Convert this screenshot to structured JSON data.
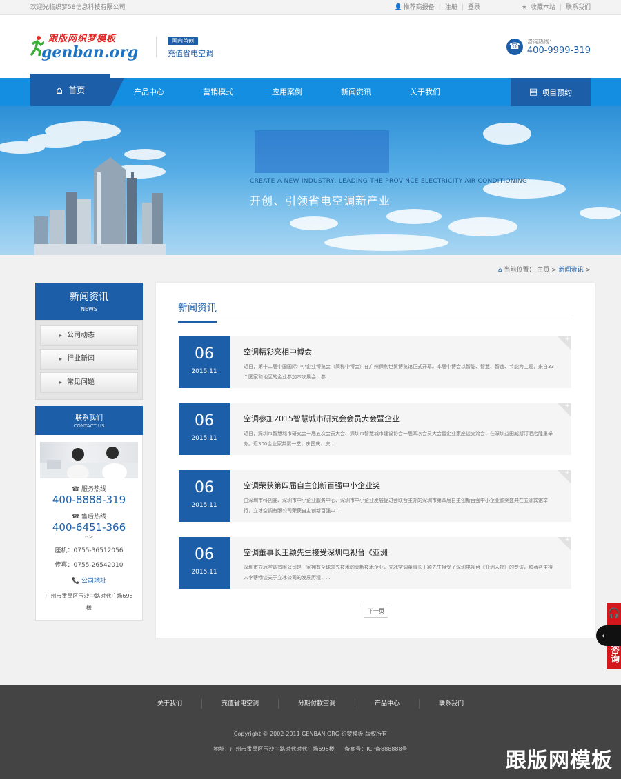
{
  "topbar": {
    "welcome": "欢迎光临织梦58信息科技有限公司",
    "links": [
      "推荐商报备",
      "注册",
      "登录"
    ],
    "right_links": [
      "收藏本站",
      "联系我们"
    ]
  },
  "header": {
    "logo_cn": "跟版网织梦模板",
    "logo_en": "genban.org",
    "badge": "国内首创",
    "slogan": "充值省电空调",
    "hotline_label": "咨询热线：",
    "hotline_number": "400-9999-319"
  },
  "nav": {
    "home": "首页",
    "items": [
      "产品中心",
      "营销模式",
      "应用案例",
      "新闻资讯",
      "关于我们"
    ],
    "book": "项目预约"
  },
  "banner": {
    "en": "CREATE A NEW INDUSTRY, LEADING THE PROVINCE ELECTRICITY AIR CONDITIONING",
    "cn": "开创、引领省电空调新产业"
  },
  "breadcrumb": {
    "prefix": "当前位置：",
    "home": "主页",
    "sep": ">",
    "current": "新闻资讯",
    "trail": ">"
  },
  "sidebar": {
    "title": "新闻资讯",
    "subtitle": "NEWS",
    "menu": [
      "公司动态",
      "行业新闻",
      "常见问题"
    ],
    "contact_title": "联系我们",
    "contact_subtitle": "CONTACT US",
    "service_label": "服务热线",
    "service_number": "400-8888-319",
    "after_label": "售后热线",
    "after_number": "400-6451-366",
    "arrow": "-->",
    "tel": "座机：0755-36512056",
    "fax": "传真：0755-26542010",
    "addr_label": "公司地址",
    "address": "广州市番禺区玉沙中路时代广场698楼"
  },
  "main": {
    "title": "新闻资讯",
    "news": [
      {
        "day": "06",
        "ym": "2015.11",
        "title": "空调精彩亮相中博会",
        "desc": "近日，第十二届中国国际中小企业博览会（简称中博会）在广州保利世贸博览馆正式开幕。本届中博会以智能、智慧、智造、节能为主题，来自33个国家和地区的企业参加本次展会，参..."
      },
      {
        "day": "06",
        "ym": "2015.11",
        "title": "空调参加2015智慧城市研究会会员大会暨企业",
        "desc": "近日，深圳市智慧城市研究会一届五次会员大会、深圳市智慧城市建设协会一届四次会员大会暨企业家座谈交流会，在深圳益田威斯汀酒店隆重举办。近300企业家共聚一堂，庆国庆、庆..."
      },
      {
        "day": "06",
        "ym": "2015.11",
        "title": "空调荣获第四届自主创新百强中小企业奖",
        "desc": "由深圳市科创委、深圳市中小企业服务中心、深圳市中小企业发展促进会联合主办的深圳市第四届自主创新百强中小企业颁奖盛典在五洲宾馆举行，立冰空调有限公司荣获自主创新百强中..."
      },
      {
        "day": "06",
        "ym": "2015.11",
        "title": "空调董事长王颖先生接受深圳电视台《亚洲",
        "desc": "深圳市立冰空调有限公司是一家拥有全球领先技术的高新技术企业，立冰空调董事长王颖先生接受了深圳电视台《亚洲人物》的专访，和著名主持人李蒂畅谈关于立冰公司的发展历程，..."
      }
    ],
    "next_page": "下一页"
  },
  "float": {
    "toggle": "‹",
    "online": "在线咨询"
  },
  "footer": {
    "nav": [
      "关于我们",
      "充值省电空调",
      "分期付款空调",
      "产品中心",
      "联系我们"
    ],
    "copyright": "Copyright © 2002-2011 GENBAN.ORG 织梦模板 版权所有",
    "address": "地址：广州市番禺区玉沙中路时代时代广场698楼",
    "icp": "备案号：ICP备888888号",
    "watermark": "跟版网模板"
  },
  "colors": {
    "primary": "#1c5ea8",
    "nav": "#138ee0",
    "footer": "#444444",
    "float_red": "#d4171b"
  }
}
